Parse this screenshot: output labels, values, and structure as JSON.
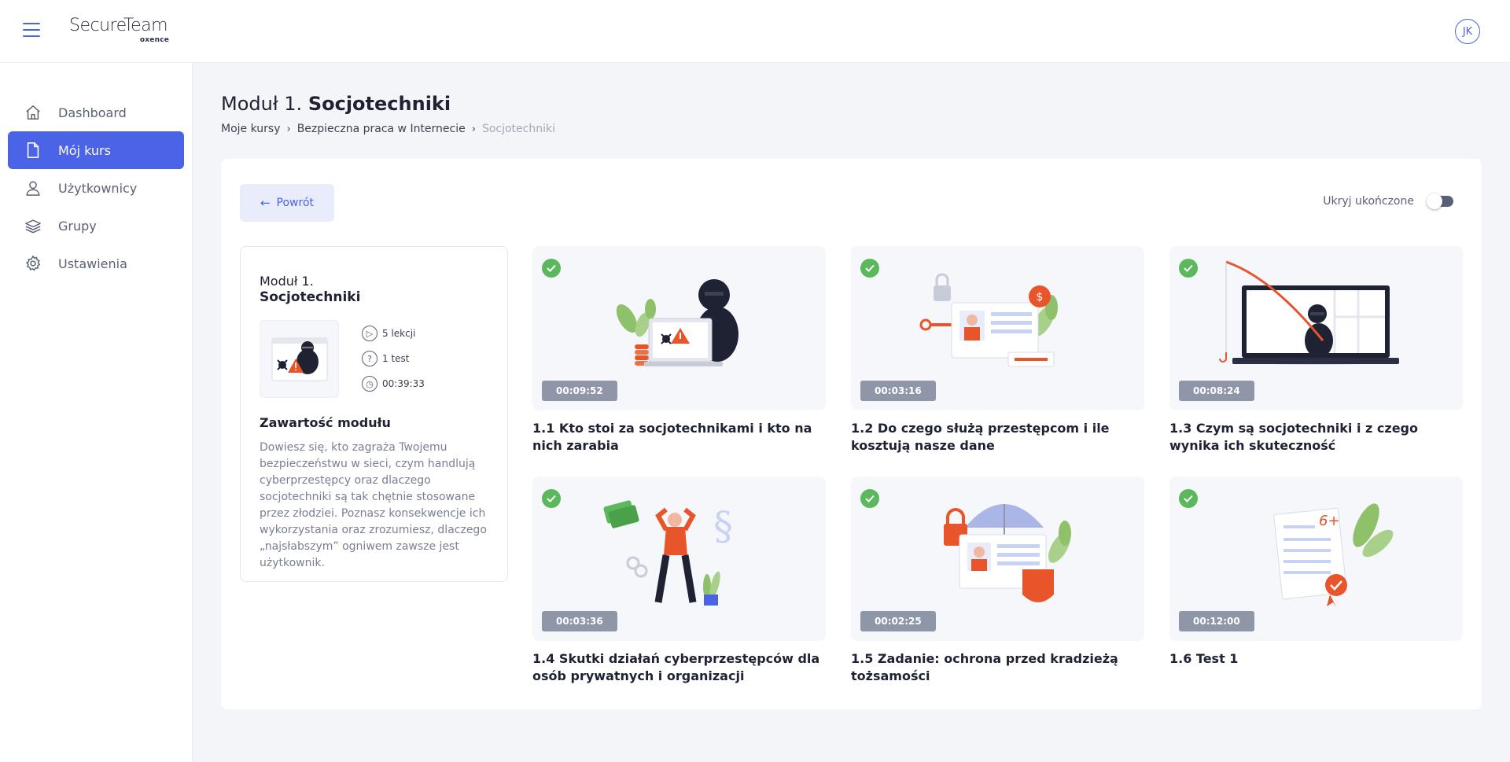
{
  "header": {
    "logo_main": "SecureTeam",
    "logo_sub": "oxence",
    "avatar_initials": "JK"
  },
  "sidebar": {
    "items": [
      {
        "label": "Dashboard",
        "icon": "home-icon",
        "active": false
      },
      {
        "label": "Mój kurs",
        "icon": "document-icon",
        "active": true
      },
      {
        "label": "Użytkownicy",
        "icon": "user-icon",
        "active": false
      },
      {
        "label": "Grupy",
        "icon": "layers-icon",
        "active": false
      },
      {
        "label": "Ustawienia",
        "icon": "gear-icon",
        "active": false
      }
    ]
  },
  "page": {
    "title_prefix": "Moduł 1.",
    "title_name": "Socjotechniki",
    "breadcrumb": [
      "Moje kursy",
      "Bezpieczna praca w Internecie",
      "Socjotechniki"
    ]
  },
  "controls": {
    "back_label": "Powrót",
    "hide_completed_label": "Ukryj ukończone",
    "hide_completed_on": false
  },
  "module": {
    "number": "Moduł 1.",
    "name": "Socjotechniki",
    "lessons": "5 lekcji",
    "tests": "1 test",
    "duration": "00:39:33",
    "content_title": "Zawartość modułu",
    "description": "Dowiesz się, kto zagraża Twojemu bezpieczeństwu w sieci, czym handlują cyberprzestępcy oraz dlaczego socjotechniki są tak chętnie stosowane przez złodziei. Poznasz konsekwencje ich wykorzystania oraz zrozumiesz, dlaczego „najsłabszym” ogniwem zawsze jest użytkownik."
  },
  "lessons": [
    {
      "title": "1.1 Kto stoi za socjotechnikami i kto na nich zarabia",
      "duration": "00:09:52",
      "completed": true,
      "illustration": "hacker-laptop-icon"
    },
    {
      "title": "1.2 Do czego służą przestępcom i ile kosztują nasze dane",
      "duration": "00:03:16",
      "completed": true,
      "illustration": "id-card-lock-icon"
    },
    {
      "title": "1.3 Czym są socjotechniki i z czego wynika ich skuteczność",
      "duration": "00:08:24",
      "completed": true,
      "illustration": "phishing-laptop-icon"
    },
    {
      "title": "1.4 Skutki działań cyberprzestępców dla osób prywatnych i organizacji",
      "duration": "00:03:36",
      "completed": true,
      "illustration": "stressed-person-icon"
    },
    {
      "title": "1.5 Zadanie: ochrona przed kradzieżą tożsamości",
      "duration": "00:02:25",
      "completed": true,
      "illustration": "identity-umbrella-icon"
    },
    {
      "title": "1.6 Test 1",
      "duration": "00:12:00",
      "completed": true,
      "illustration": "test-sheet-icon"
    }
  ],
  "colors": {
    "accent": "#4a63e7",
    "success": "#5cb85c",
    "duration_badge": "#8f96a8",
    "illustration_orange": "#e8552a"
  }
}
